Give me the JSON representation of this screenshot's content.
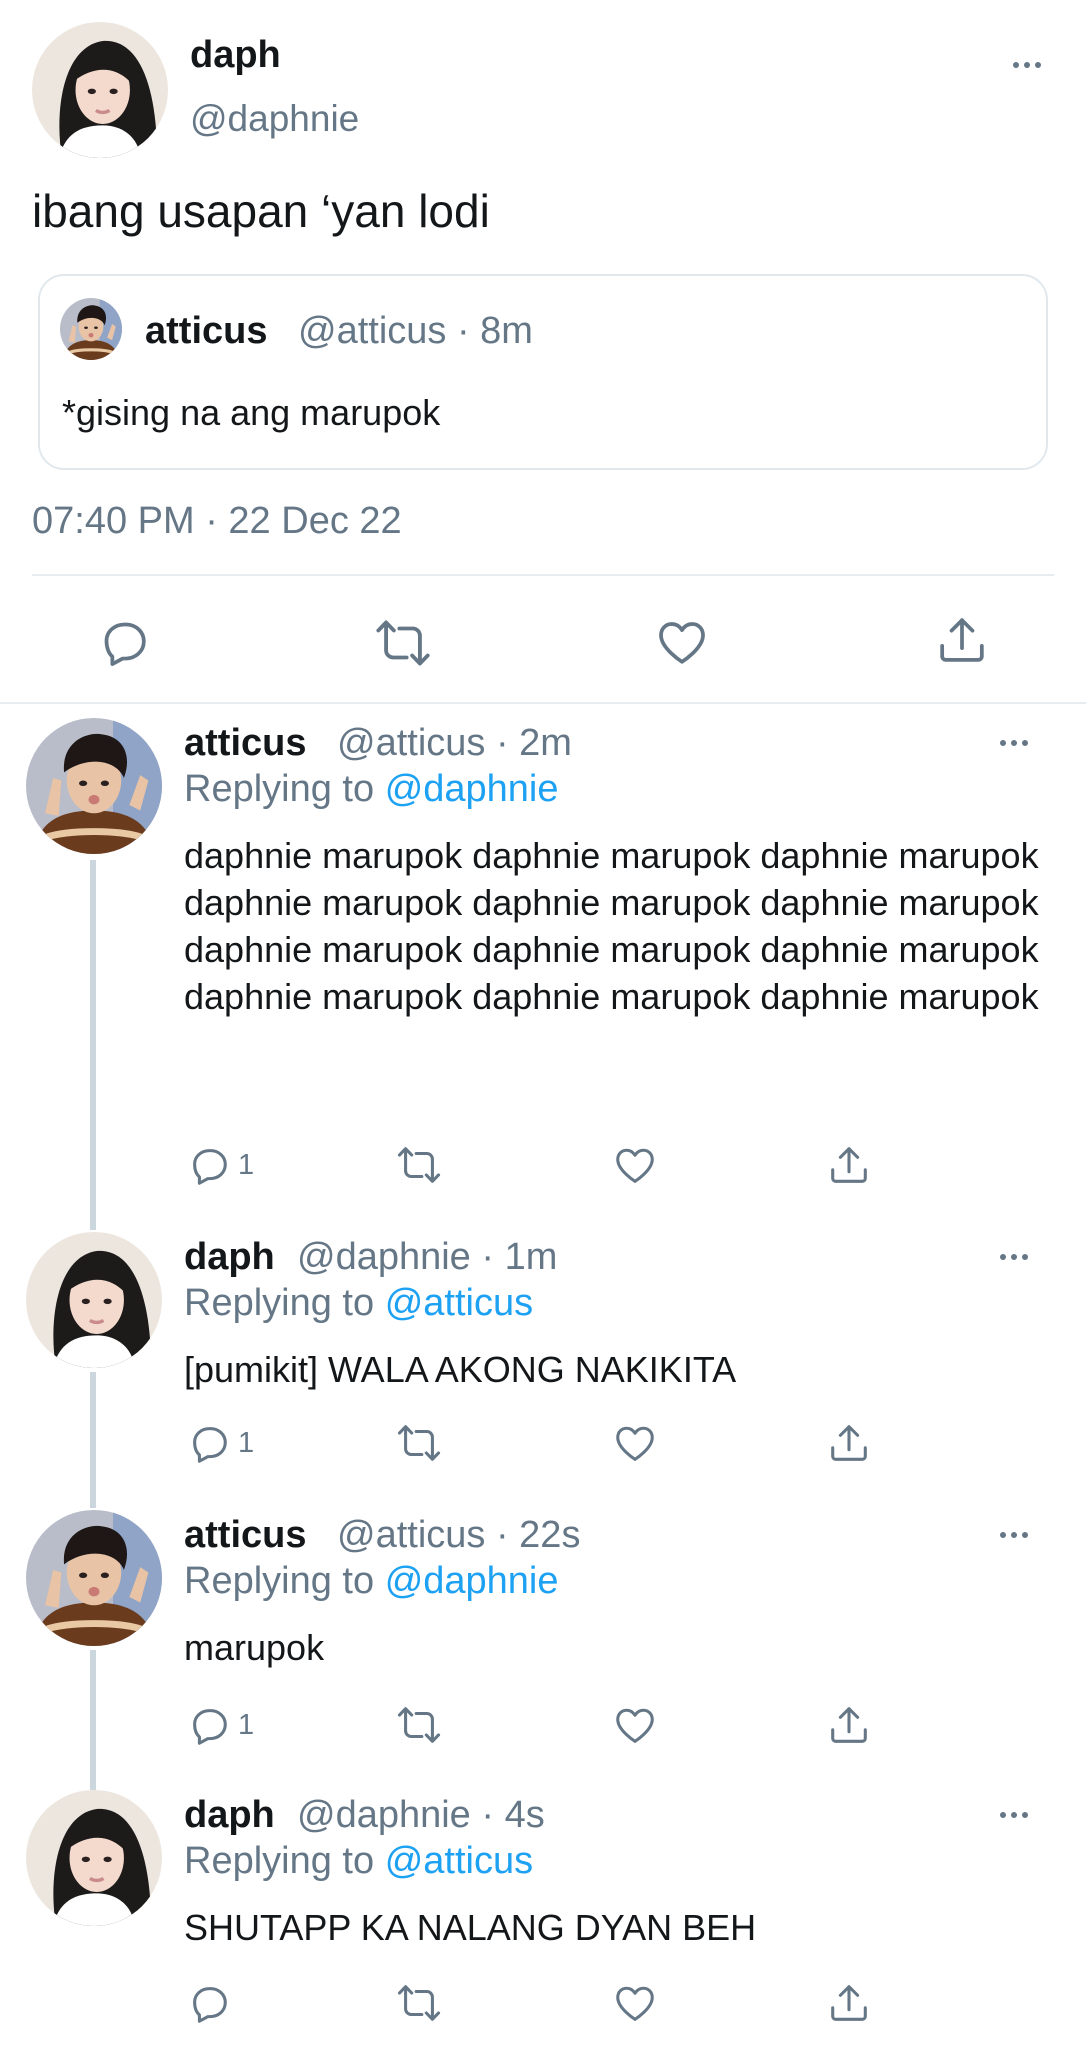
{
  "main_tweet": {
    "author_name": "daph",
    "author_handle": "@daphnie",
    "text": "ibang usapan ‘yan lodi",
    "timestamp": "07:40 PM · 22 Dec 22",
    "quote": {
      "author_name": "atticus",
      "meta": "@atticus · 8m",
      "text": "*gising na ang marupok"
    },
    "actions": [
      "reply-icon",
      "retweet-icon",
      "like-icon",
      "share-icon"
    ]
  },
  "replies": [
    {
      "author_name": "atticus",
      "meta": "@atticus · 2m",
      "replying_prefix": "Replying to",
      "replying_to": "@daphnie",
      "text": "daphnie marupok daphnie marupok daphnie marupok daphnie marupok daphnie marupok daphnie marupok daphnie marupok daphnie marupok daphnie marupok daphnie marupok daphnie marupok daphnie marupok",
      "reply_count": "1"
    },
    {
      "author_name": "daph",
      "meta": "@daphnie · 1m",
      "replying_prefix": "Replying to",
      "replying_to": "@atticus",
      "text": "[pumikit] WALA AKONG NAKIKITA",
      "reply_count": "1"
    },
    {
      "author_name": "atticus",
      "meta": "@atticus · 22s",
      "replying_prefix": "Replying to",
      "replying_to": "@daphnie",
      "text": "marupok",
      "reply_count": "1"
    },
    {
      "author_name": "daph",
      "meta": "@daphnie · 4s",
      "replying_prefix": "Replying to",
      "replying_to": "@atticus",
      "text": "SHUTAPP KA NALANG DYAN BEH",
      "reply_count": ""
    }
  ],
  "colors": {
    "text": "#14171a",
    "secondary": "#657786",
    "link": "#1da1f2",
    "border": "#e1e8ed",
    "thread_line": "#ccd6dd"
  }
}
